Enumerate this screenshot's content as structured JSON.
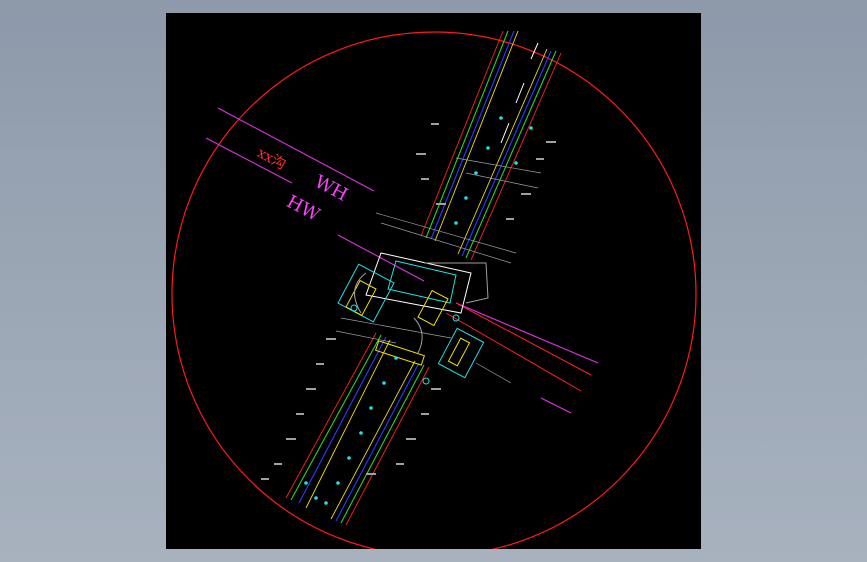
{
  "drawing": {
    "background": "#000000",
    "page_background": "#9aa5b4",
    "labels": {
      "river": "xx沟",
      "tag_top": "WH",
      "tag_bottom": "HW"
    },
    "colors": {
      "boundary_circle": "#ff1a1a",
      "river_line": "#e030e0",
      "road_edge": "#2ad22a",
      "road_blue": "#2a3cff",
      "road_yellow": "#f0e000",
      "road_red": "#ff2020",
      "annotation": "#20e0e0",
      "text_gray": "#a0a0a0",
      "label_magenta": "#ff40ff",
      "label_red": "#ff3030"
    }
  }
}
